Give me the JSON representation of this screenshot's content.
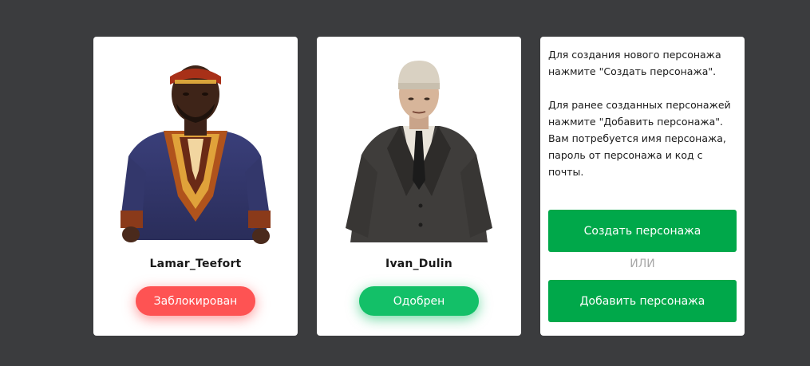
{
  "characters": [
    {
      "name": "Lamar_Teefort",
      "status_label": "Заблокирован",
      "status": "blocked",
      "status_color": "#fe5353"
    },
    {
      "name": "Ivan_Dulin",
      "status_label": "Одобрен",
      "status": "approved",
      "status_color": "#13c068"
    }
  ],
  "info": {
    "paragraph_create": "Для создания нового персонажа нажмите \"Создать персонажа\".",
    "paragraph_add": "Для ранее созданных персонажей нажмите \"Добавить персонажа\". Вам потребуется имя персонажа, пароль от персонажа и код с почты.",
    "create_button_label": "Создать персонажа",
    "or_label": "ИЛИ",
    "add_button_label": "Добавить персонажа"
  },
  "colors": {
    "background": "#3b3c3e",
    "card": "#ffffff",
    "action_green": "#00a84a"
  }
}
